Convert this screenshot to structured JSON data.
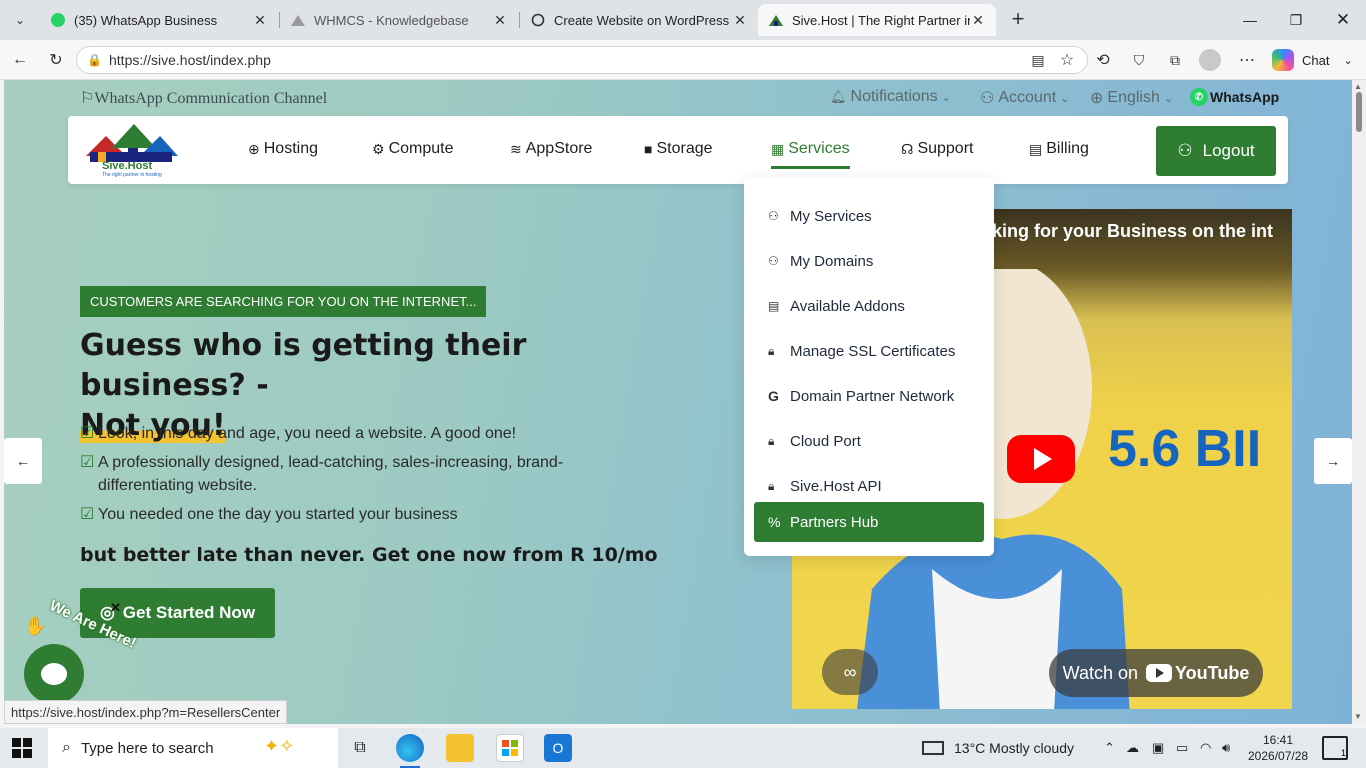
{
  "browser": {
    "tabs": [
      {
        "title": "(35) WhatsApp Business",
        "icon": "whatsapp-icon"
      },
      {
        "title": "WHMCS - Knowledgebase",
        "icon": "whmcs-icon"
      },
      {
        "title": "Create Website on WordPress",
        "icon": "openai-icon"
      },
      {
        "title": "Sive.Host | The Right Partner in Ho",
        "icon": "sivehost-icon"
      }
    ],
    "url": "https://sive.host/index.php",
    "chat_label": "Chat",
    "status_url": "https://sive.host/index.php?m=ResellersCenter"
  },
  "site": {
    "topbar": {
      "channel": "WhatsApp Communication Channel",
      "notifications": "Notifications",
      "account": "Account",
      "language": "English",
      "whatsapp": "WhatsApp"
    },
    "logo_text": "Sive.Host",
    "logo_tagline": "The right partner in hosting",
    "nav": [
      {
        "label": "Hosting",
        "icon": "globe-icon"
      },
      {
        "label": "Compute",
        "icon": "gear-icon"
      },
      {
        "label": "AppStore",
        "icon": "database-icon"
      },
      {
        "label": "Storage",
        "icon": "box-icon"
      },
      {
        "label": "Services",
        "icon": "gift-icon"
      },
      {
        "label": "Support",
        "icon": "headset-icon"
      },
      {
        "label": "Billing",
        "icon": "invoice-icon"
      }
    ],
    "logout_label": "Logout",
    "services_menu": [
      {
        "label": "My Services",
        "icon": "user-icon"
      },
      {
        "label": "My Domains",
        "icon": "user-icon"
      },
      {
        "label": "Available Addons",
        "icon": "document-icon"
      },
      {
        "label": "Manage SSL Certificates",
        "icon": "lock-icon"
      },
      {
        "label": "Domain Partner Network",
        "icon": "google-icon"
      },
      {
        "label": "Cloud Port",
        "icon": "lock-icon"
      },
      {
        "label": "Sive.Host API",
        "icon": "lock-icon"
      },
      {
        "label": "Partners Hub",
        "icon": "percent-icon"
      }
    ],
    "hero": {
      "badge": "CUSTOMERS ARE SEARCHING FOR YOU ON THE INTERNET...",
      "headline": "Guess who is getting their business? -",
      "headline_highlight": "Not you!",
      "bullets": [
        "Look, in this day and age, you need a website. A good one!",
        "A professionally designed, lead-catching, sales-increasing, brand-differentiating website.",
        "You needed one the day you started your business"
      ],
      "tagline": "but better late than never. Get one now from R 10/mo",
      "cta": "Get Started Now"
    },
    "video": {
      "title": "king for your Business on the int",
      "big_text": "5.6 BII",
      "watch_on": "Watch on",
      "youtube": "YouTube"
    },
    "chat_widget": "We Are Here!"
  },
  "taskbar": {
    "search_placeholder": "Type here to search",
    "weather": "13°C  Mostly cloudy",
    "time": "16:41",
    "date": "2026/07/28",
    "notif_count": "1"
  }
}
